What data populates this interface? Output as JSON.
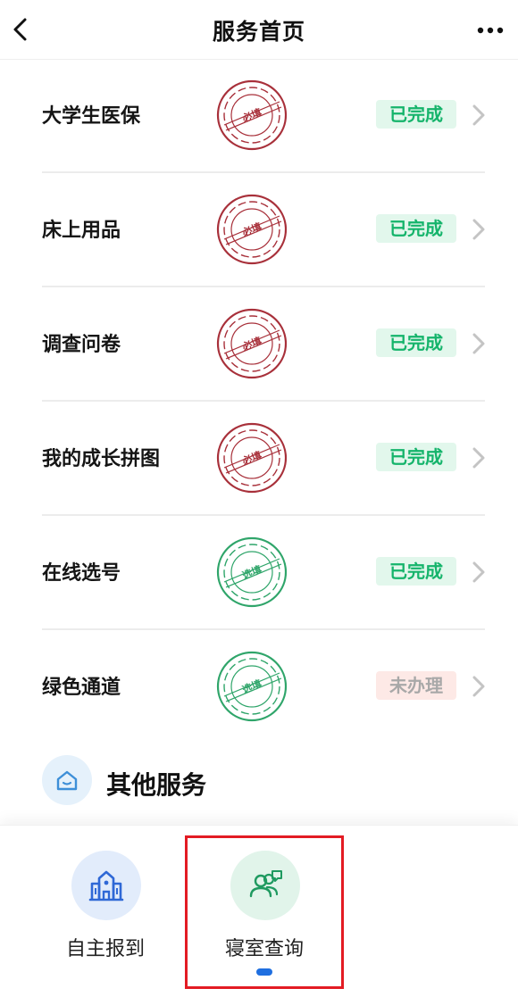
{
  "header": {
    "title": "服务首页",
    "back_icon": "chevron-left-icon",
    "more_icon": "more-dots-icon"
  },
  "items": [
    {
      "label": "大学生医保",
      "tag": "必填",
      "tag_type": "required",
      "status": "已完成",
      "status_type": "done"
    },
    {
      "label": "床上用品",
      "tag": "必填",
      "tag_type": "required",
      "status": "已完成",
      "status_type": "done"
    },
    {
      "label": "调查问卷",
      "tag": "必填",
      "tag_type": "required",
      "status": "已完成",
      "status_type": "done"
    },
    {
      "label": "我的成长拼图",
      "tag": "必填",
      "tag_type": "required",
      "status": "已完成",
      "status_type": "done"
    },
    {
      "label": "在线选号",
      "tag": "选填",
      "tag_type": "optional",
      "status": "已完成",
      "status_type": "done"
    },
    {
      "label": "绿色通道",
      "tag": "选填",
      "tag_type": "optional",
      "status": "未办理",
      "status_type": "pending"
    }
  ],
  "section": {
    "title": "其他服务",
    "icon": "home-icon"
  },
  "services": [
    {
      "label": "自主报到",
      "icon": "building-icon"
    },
    {
      "label": "寝室查询",
      "icon": "people-chat-icon"
    }
  ],
  "colors": {
    "required_stamp": "#a8303a",
    "optional_stamp": "#2fa56a",
    "done_text": "#15b46b",
    "done_bg": "#e2f7ec",
    "pending_bg": "#fde9e6",
    "pending_text": "#a8a8a8",
    "highlight": "#e31b23",
    "indicator": "#1f6fe0"
  }
}
